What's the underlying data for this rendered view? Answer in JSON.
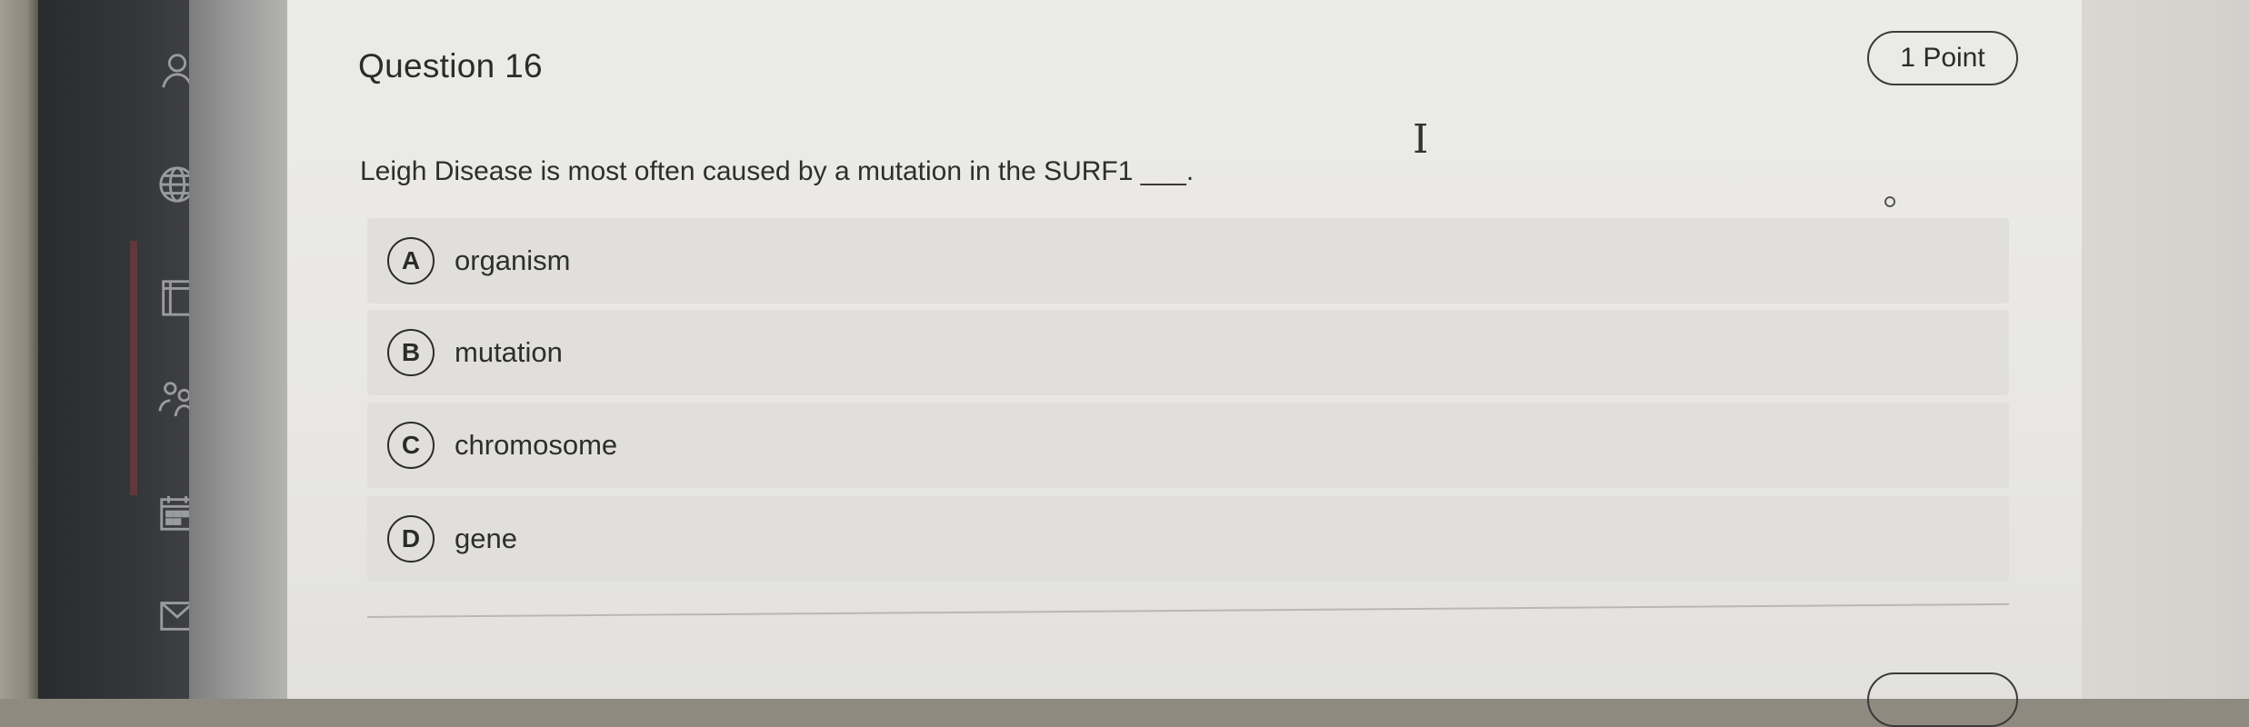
{
  "question": {
    "title": "Question 16",
    "points": "1 Point",
    "prompt": "Leigh Disease is most often caused by a mutation in the SURF1 ___.",
    "options": [
      {
        "letter": "A",
        "label": "organism"
      },
      {
        "letter": "B",
        "label": "mutation"
      },
      {
        "letter": "C",
        "label": "chromosome"
      },
      {
        "letter": "D",
        "label": "gene"
      }
    ]
  },
  "sidebar": {
    "icons": [
      "person-icon",
      "globe-icon",
      "book-icon",
      "people-icon",
      "calendar-icon",
      "inbox-icon"
    ]
  }
}
